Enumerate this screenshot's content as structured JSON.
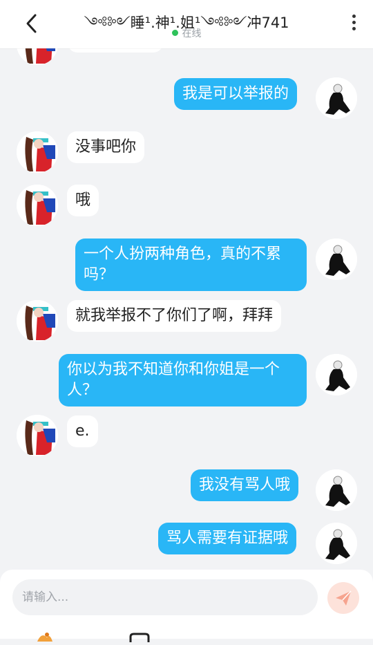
{
  "header": {
    "title": "༺༻睡¹.神¹.姐¹༺༻冲741",
    "status": "在线"
  },
  "messages": [
    {
      "side": "in",
      "text": ""
    },
    {
      "side": "out",
      "text": "我是可以举报的"
    },
    {
      "side": "in",
      "text": "没事吧你"
    },
    {
      "side": "in",
      "text": "哦"
    },
    {
      "side": "out",
      "text": "一个人扮两种角色，真的不累吗？"
    },
    {
      "side": "in",
      "text": "就我举报不了你们了啊，拜拜"
    },
    {
      "side": "out",
      "text": "你以为我不知道你和你姐是一个人？"
    },
    {
      "side": "in",
      "text": "e."
    },
    {
      "side": "out",
      "text": "我没有骂人哦"
    },
    {
      "side": "out",
      "text": "骂人需要有证据哦"
    }
  ],
  "composer": {
    "placeholder": "请输入..."
  },
  "colors": {
    "outgoing_bubble": "#29b6f6",
    "incoming_bubble": "#ffffff",
    "online_dot": "#2fc25b",
    "send_button": "#fde2da"
  },
  "icons": {
    "back": "chevron-left-icon",
    "more": "more-vertical-icon",
    "send": "paper-plane-icon"
  }
}
